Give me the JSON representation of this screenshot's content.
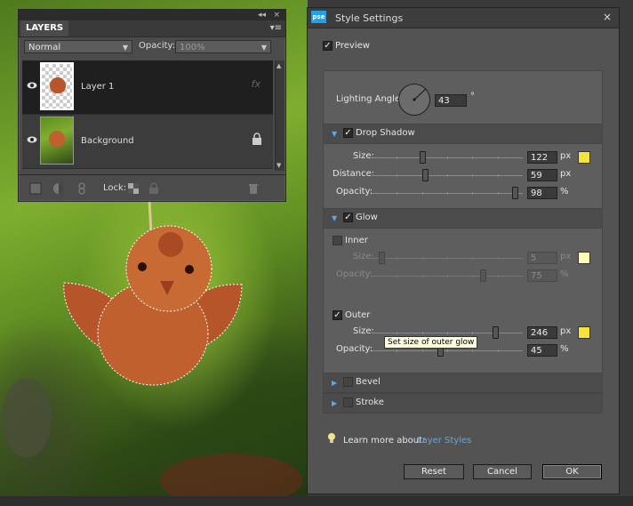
{
  "layers_panel": {
    "tab_title": "LAYERS",
    "blend_mode": "Normal",
    "opacity_label": "Opacity:",
    "opacity_value": "100%",
    "layers": [
      {
        "name": "Layer 1",
        "selected": true
      },
      {
        "name": "Background",
        "selected": false
      }
    ],
    "lock_label": "Lock:"
  },
  "dialog": {
    "title": "Style Settings",
    "logo_text": "pse",
    "close_glyph": "×",
    "preview_label": "Preview",
    "lighting_angle_label": "Lighting Angle:",
    "lighting_angle_value": "43",
    "degree_symbol": "°",
    "drop_shadow": {
      "label": "Drop Shadow",
      "size_label": "Size:",
      "size_value": "122",
      "size_unit": "px",
      "distance_label": "Distance:",
      "distance_value": "59",
      "distance_unit": "px",
      "opacity_label": "Opacity:",
      "opacity_value": "98",
      "opacity_unit": "%",
      "color": "#f5e23a"
    },
    "glow": {
      "label": "Glow",
      "inner_label": "Inner",
      "inner_size_label": "Size:",
      "inner_size_value": "5",
      "inner_size_unit": "px",
      "inner_opacity_label": "Opacity:",
      "inner_opacity_value": "75",
      "inner_opacity_unit": "%",
      "inner_color": "#fffbb5",
      "outer_label": "Outer",
      "outer_size_label": "Size:",
      "outer_size_value": "246",
      "outer_size_unit": "px",
      "outer_opacity_label": "Opacity:",
      "outer_opacity_value": "45",
      "outer_opacity_unit": "%",
      "outer_color": "#f5e23a"
    },
    "bevel_label": "Bevel",
    "stroke_label": "Stroke",
    "learn_more_label": "Learn more about:",
    "learn_more_link": "Layer Styles",
    "reset_label": "Reset",
    "cancel_label": "Cancel",
    "ok_label": "OK"
  },
  "tooltip": "Set size of outer glow"
}
